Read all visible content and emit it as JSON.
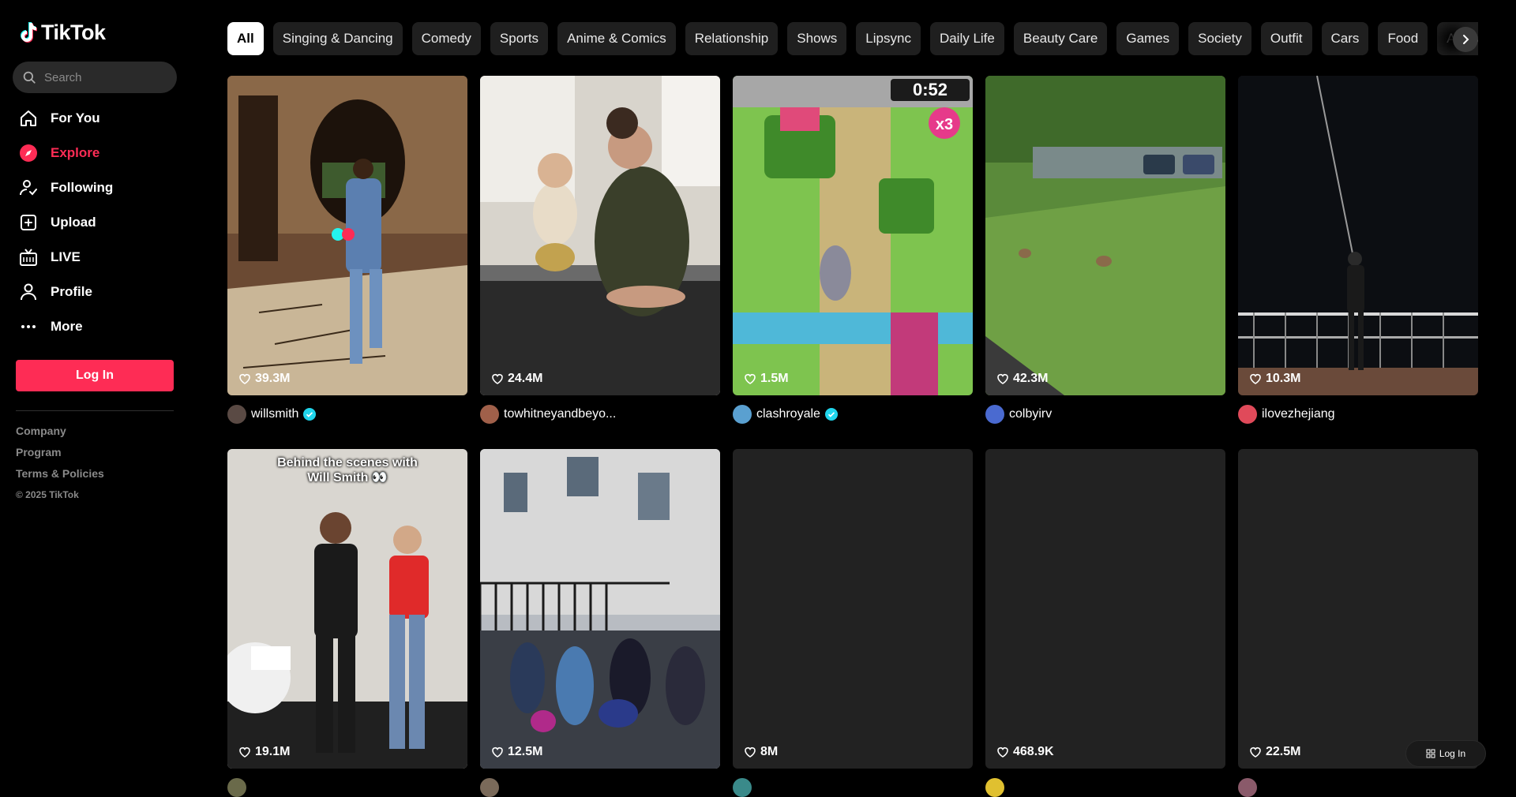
{
  "app": {
    "name": "TikTok"
  },
  "search": {
    "placeholder": "Search"
  },
  "nav": [
    {
      "label": "For You",
      "icon": "home-icon"
    },
    {
      "label": "Explore",
      "icon": "compass-icon",
      "active": true
    },
    {
      "label": "Following",
      "icon": "following-icon"
    },
    {
      "label": "Upload",
      "icon": "upload-icon"
    },
    {
      "label": "LIVE",
      "icon": "live-icon"
    },
    {
      "label": "Profile",
      "icon": "profile-icon"
    },
    {
      "label": "More",
      "icon": "more-icon"
    }
  ],
  "login_label": "Log In",
  "footer": {
    "links": [
      "Company",
      "Program",
      "Terms & Policies"
    ],
    "copyright": "© 2025 TikTok"
  },
  "tabs": [
    "All",
    "Singing & Dancing",
    "Comedy",
    "Sports",
    "Anime & Comics",
    "Relationship",
    "Shows",
    "Lipsync",
    "Daily Life",
    "Beauty Care",
    "Games",
    "Society",
    "Outfit",
    "Cars",
    "Food",
    "Animals"
  ],
  "active_tab": "All",
  "videos": [
    {
      "likes": "39.3M",
      "author": "willsmith",
      "verified": true
    },
    {
      "likes": "24.4M",
      "author": "towhitneyandbeyo...",
      "verified": false
    },
    {
      "likes": "1.5M",
      "author": "clashroyale",
      "verified": true
    },
    {
      "likes": "42.3M",
      "author": "colbyirv",
      "verified": false
    },
    {
      "likes": "10.3M",
      "author": "ilovezhejiang",
      "verified": false
    },
    {
      "likes": "19.1M",
      "author": "",
      "verified": true,
      "caption": "Behind the scenes with\nWill Smith 👀"
    },
    {
      "likes": "12.5M",
      "author": "",
      "verified": false
    },
    {
      "likes": "8M",
      "author": "",
      "verified": false
    },
    {
      "likes": "468.9K",
      "author": "",
      "verified": true
    },
    {
      "likes": "22.5M",
      "author": "",
      "verified": false
    }
  ],
  "float_login_label": "Log In",
  "colors": {
    "accent": "#fe2c55",
    "verified": "#20d5ec",
    "background": "#000000"
  }
}
